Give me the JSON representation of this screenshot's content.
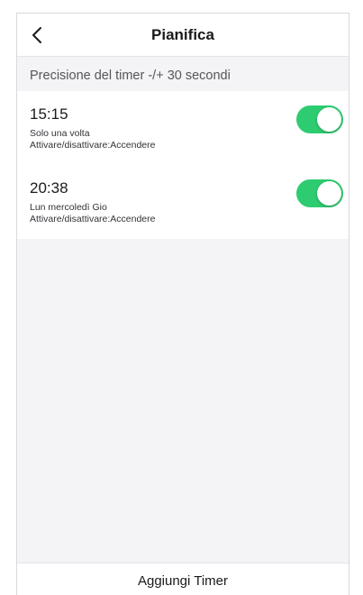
{
  "header": {
    "title": "Pianifica",
    "back_icon": "chevron-left-icon"
  },
  "notice": "Precisione del timer -/+ 30 secondi",
  "timers": [
    {
      "time": "15:15",
      "repeat": "Solo una volta",
      "action": "Attivare/disattivare:Accendere",
      "enabled": true
    },
    {
      "time": "20:38",
      "repeat": "Lun mercoledì Gio",
      "action": "Attivare/disattivare:Accendere",
      "enabled": true
    }
  ],
  "footer": {
    "add_label": "Aggiungi Timer"
  },
  "colors": {
    "toggle_on": "#2ecc71",
    "background": "#f4f4f7"
  }
}
